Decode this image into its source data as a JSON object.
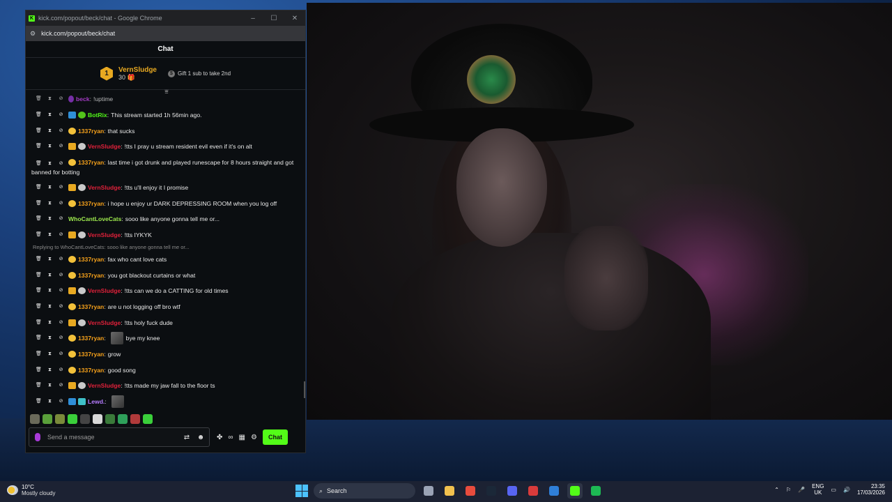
{
  "browser": {
    "title": "kick.com/popout/beck/chat - Google Chrome",
    "url": "kick.com/popout/beck/chat",
    "minimize": "–",
    "maximize": "☐",
    "close": "✕"
  },
  "chat": {
    "header": "Chat",
    "top_gifter": {
      "rank": "1",
      "name": "VernSludge",
      "count": "30",
      "cta": "Gift 1 sub to take 2nd"
    },
    "messages": [
      {
        "user": "beck",
        "color": "#d64bff",
        "badges": [
          "mic"
        ],
        "text": "!uptime",
        "faded": true
      },
      {
        "user": "BotRix",
        "color": "#53fc18",
        "badges": [
          "bot",
          "verify"
        ],
        "text": "This stream started 1h 56min ago."
      },
      {
        "user": "1337ryan",
        "color": "#f7a21b",
        "badges": [
          "emoji"
        ],
        "text": "that sucks"
      },
      {
        "user": "VernSludge",
        "color": "#e0213a",
        "badges": [
          "crown",
          "cat"
        ],
        "text": "!tts I pray u stream resident evil even if it's on alt"
      },
      {
        "user": "1337ryan",
        "color": "#f7a21b",
        "badges": [
          "emoji"
        ],
        "text": "last time i got drunk and played runescape for 8 hours straight and got banned for botting",
        "two_line": true
      },
      {
        "user": "VernSludge",
        "color": "#e0213a",
        "badges": [
          "crown",
          "cat"
        ],
        "text": "!tts u'll enjoy it I promise"
      },
      {
        "user": "1337ryan",
        "color": "#f7a21b",
        "badges": [
          "emoji"
        ],
        "text": "i hope u enjoy ur DARK DEPRESSING ROOM when you log off"
      },
      {
        "user": "WhoCantLoveCats",
        "color": "#9eea4e",
        "badges": [],
        "text": "sooo like anyone gonna tell me or..."
      },
      {
        "user": "VernSludge",
        "color": "#e0213a",
        "badges": [
          "crown",
          "cat"
        ],
        "text": "!tts IYKYK"
      },
      {
        "reply": "Replying to WhoCantLoveCats: sooo like anyone gonna tell me or..."
      },
      {
        "user": "1337ryan",
        "color": "#f7a21b",
        "badges": [
          "emoji"
        ],
        "text": "fax who cant love cats"
      },
      {
        "user": "1337ryan",
        "color": "#f7a21b",
        "badges": [
          "emoji"
        ],
        "text": "you got blackout curtains or what"
      },
      {
        "user": "VernSludge",
        "color": "#e0213a",
        "badges": [
          "crown",
          "cat"
        ],
        "text": "!tts can we do a CATTING for old times"
      },
      {
        "user": "1337ryan",
        "color": "#f7a21b",
        "badges": [
          "emoji"
        ],
        "text": "are u not logging off bro wtf"
      },
      {
        "user": "VernSludge",
        "color": "#e0213a",
        "badges": [
          "crown",
          "cat"
        ],
        "text": "!tts holy fuck dude"
      },
      {
        "user": "1337ryan",
        "color": "#f7a21b",
        "badges": [
          "emoji"
        ],
        "text": "bye my knee",
        "emote": true
      },
      {
        "user": "1337ryan",
        "color": "#f7a21b",
        "badges": [
          "emoji"
        ],
        "text": "grow"
      },
      {
        "user": "1337ryan",
        "color": "#f7a21b",
        "badges": [
          "emoji"
        ],
        "text": "good song"
      },
      {
        "user": "VernSludge",
        "color": "#e0213a",
        "badges": [
          "crown",
          "cat"
        ],
        "text": "!tts made my jaw fall to the floor ts"
      },
      {
        "user": "Lewd.",
        "color": "#b57bff",
        "badges": [
          "bot",
          "teal"
        ],
        "text": "",
        "emote": true
      }
    ],
    "emote_bar_colors": [
      "#6a6a5a",
      "#5aa03a",
      "#7a8a3a",
      "#3acf3a",
      "#444",
      "#d8d8d8",
      "#3a7a3a",
      "#2ea05a",
      "#b03a3a",
      "#3acf3a"
    ],
    "input_placeholder": "Send a message",
    "send_label": "Chat"
  },
  "taskbar": {
    "weather_temp": "10°C",
    "weather_desc": "Mostly cloudy",
    "search_label": "Search",
    "lang_top": "ENG",
    "lang_bottom": "UK",
    "time": "23:35",
    "date": "17/03/2026",
    "apps": [
      {
        "name": "task-view",
        "color": "#9aa3b5"
      },
      {
        "name": "file-explorer",
        "color": "#f2c14e"
      },
      {
        "name": "chrome",
        "color": "#e84c3d"
      },
      {
        "name": "steam",
        "color": "#1b2838"
      },
      {
        "name": "discord",
        "color": "#5865f2"
      },
      {
        "name": "app-red",
        "color": "#d83b3b"
      },
      {
        "name": "app-blue",
        "color": "#2f7fd8"
      },
      {
        "name": "kick",
        "color": "#53fc18",
        "active": true
      },
      {
        "name": "spotify",
        "color": "#1db954"
      }
    ]
  }
}
